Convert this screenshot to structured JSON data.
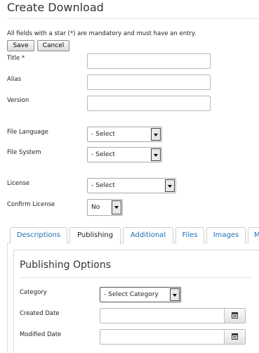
{
  "page_title": "Create Download",
  "mandatory_note": "All fields with a star (*) are mandatory and must have an entry.",
  "toolbar": {
    "save_label": "Save",
    "cancel_label": "Cancel"
  },
  "fields": {
    "title_label": "Title *",
    "alias_label": "Alias",
    "version_label": "Version",
    "file_language_label": "File Language",
    "file_language_value": "- Select",
    "file_system_label": "File System",
    "file_system_value": "- Select",
    "license_label": "License",
    "license_value": "- Select",
    "confirm_license_label": "Confirm License",
    "confirm_license_value": "No"
  },
  "tabs": [
    {
      "label": "Descriptions",
      "active": false
    },
    {
      "label": "Publishing",
      "active": true
    },
    {
      "label": "Additional",
      "active": false
    },
    {
      "label": "Files",
      "active": false
    },
    {
      "label": "Images",
      "active": false
    },
    {
      "label": "M",
      "active": false
    }
  ],
  "publishing": {
    "title": "Publishing Options",
    "category_label": "Category",
    "category_value": "- Select Category",
    "created_date_label": "Created Date",
    "modified_date_label": "Modified Date"
  },
  "icons": {
    "select_arrow": "chevron-down-icon",
    "calendar": "calendar-icon"
  }
}
